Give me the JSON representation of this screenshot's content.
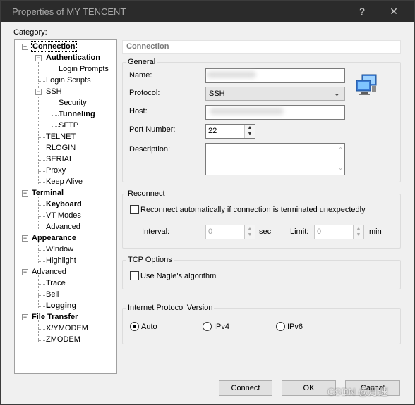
{
  "window": {
    "title": "Properties of MY TENCENT",
    "help_glyph": "?",
    "close_glyph": "✕"
  },
  "category_label": "Category:",
  "tree": {
    "connection": "Connection",
    "authentication": "Authentication",
    "login_prompts": "Login Prompts",
    "login_scripts": "Login Scripts",
    "ssh": "SSH",
    "security": "Security",
    "tunneling": "Tunneling",
    "sftp": "SFTP",
    "telnet": "TELNET",
    "rlogin": "RLOGIN",
    "serial": "SERIAL",
    "proxy": "Proxy",
    "keep_alive": "Keep Alive",
    "terminal": "Terminal",
    "keyboard": "Keyboard",
    "vt_modes": "VT Modes",
    "advanced_terminal": "Advanced",
    "appearance": "Appearance",
    "window": "Window",
    "highlight": "Highlight",
    "advanced": "Advanced",
    "trace": "Trace",
    "bell": "Bell",
    "logging": "Logging",
    "file_transfer": "File Transfer",
    "xymodem": "X/YMODEM",
    "zmodem": "ZMODEM"
  },
  "panel_header": "Connection",
  "general": {
    "title": "General",
    "name_label": "Name:",
    "name_value": "",
    "protocol_label": "Protocol:",
    "protocol_value": "SSH",
    "host_label": "Host:",
    "host_value": "",
    "port_label": "Port Number:",
    "port_value": "22",
    "description_label": "Description:",
    "description_value": ""
  },
  "reconnect": {
    "title": "Reconnect",
    "checkbox_label": "Reconnect automatically if connection is terminated unexpectedly",
    "interval_label": "Interval:",
    "interval_value": "0",
    "interval_unit": "sec",
    "limit_label": "Limit:",
    "limit_value": "0",
    "limit_unit": "min"
  },
  "tcp": {
    "title": "TCP Options",
    "nagle_label": "Use Nagle's algorithm"
  },
  "ip_version": {
    "title": "Internet Protocol Version",
    "auto": "Auto",
    "ipv4": "IPv4",
    "ipv6": "IPv6",
    "selected": "Auto"
  },
  "buttons": {
    "connect": "Connect",
    "ok": "OK",
    "cancel": "Cancel"
  },
  "watermark": "CSDN @月速"
}
